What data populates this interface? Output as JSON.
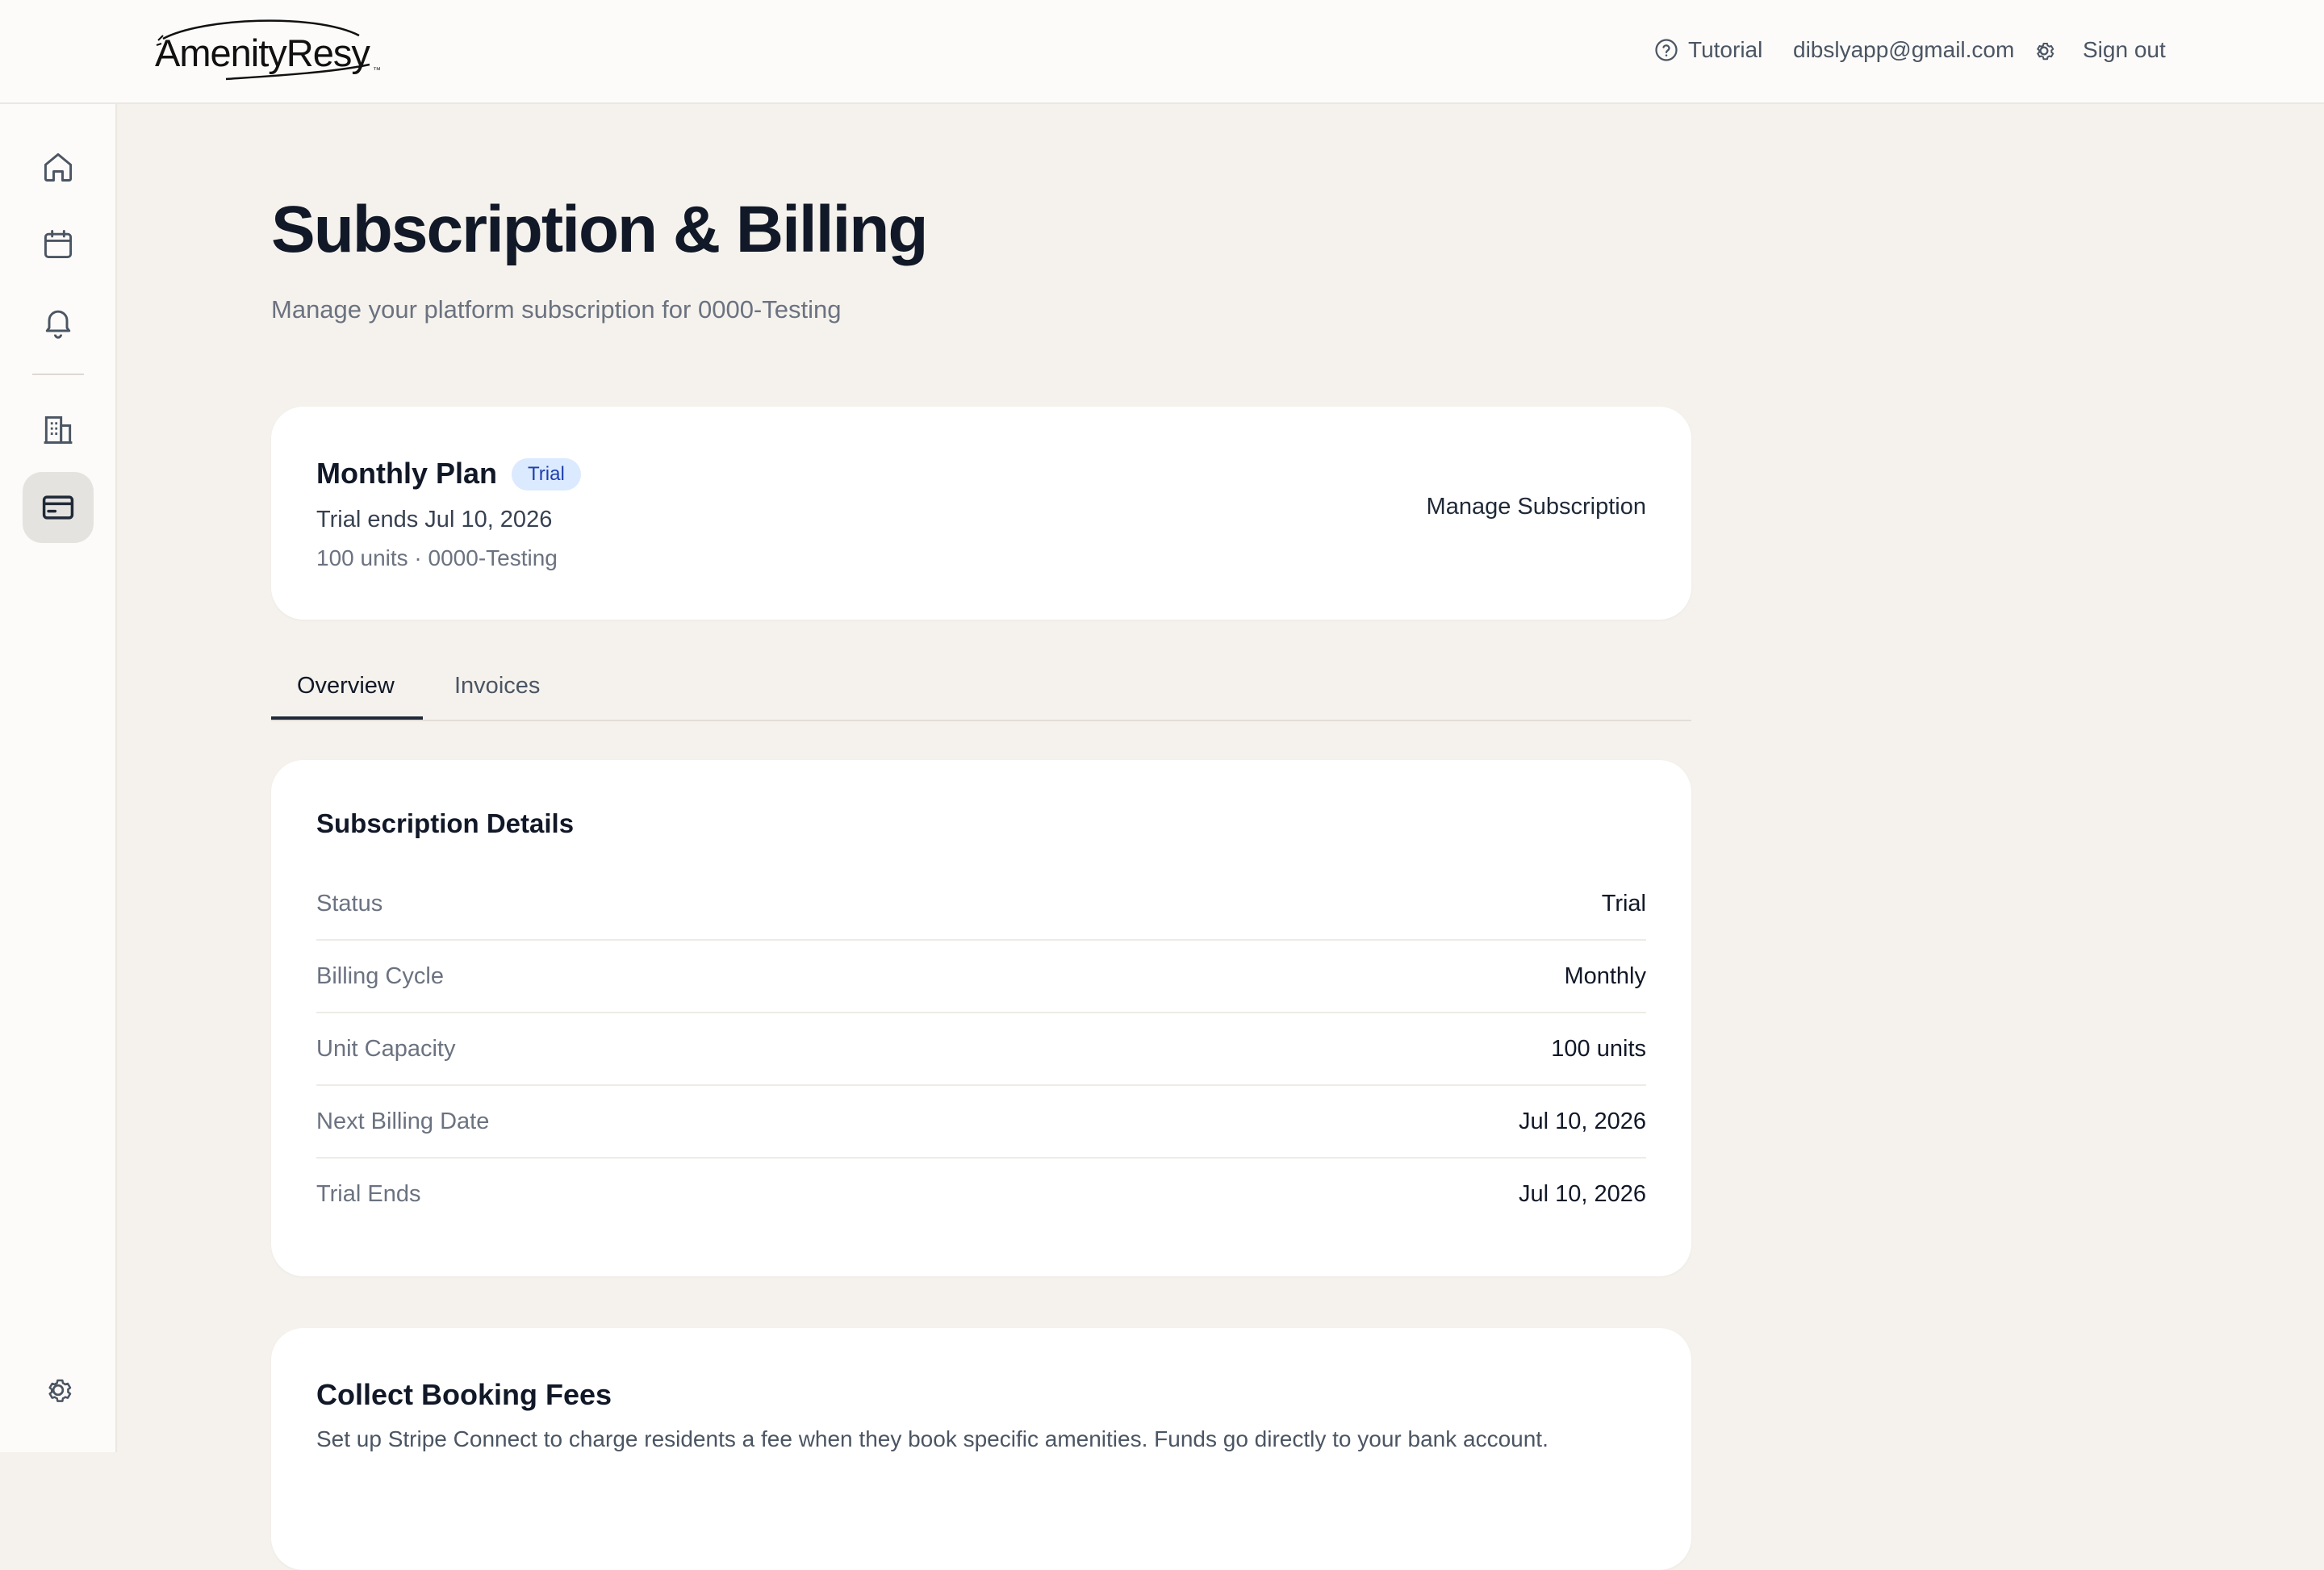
{
  "header": {
    "logo_text": "AmenityResy",
    "logo_tm": "™",
    "tutorial_label": "Tutorial",
    "user_email": "dibslyapp@gmail.com",
    "signout_label": "Sign out"
  },
  "sidebar": {
    "items": [
      {
        "icon": "home-icon",
        "active": false
      },
      {
        "icon": "calendar-icon",
        "active": false
      },
      {
        "icon": "bell-icon",
        "active": false
      },
      {
        "icon": "building-icon",
        "active": false
      },
      {
        "icon": "credit-card-icon",
        "active": true
      },
      {
        "icon": "gear-icon",
        "active": false
      }
    ]
  },
  "page": {
    "title": "Subscription & Billing",
    "subtitle": "Manage your platform subscription for 0000-Testing"
  },
  "plan": {
    "name": "Monthly Plan",
    "badge": "Trial",
    "trial_ends": "Trial ends Jul 10, 2026",
    "units_line": "100 units · 0000-Testing",
    "manage_label": "Manage Subscription"
  },
  "tabs": [
    {
      "label": "Overview",
      "active": true
    },
    {
      "label": "Invoices",
      "active": false
    }
  ],
  "details": {
    "title": "Subscription Details",
    "rows": [
      {
        "label": "Status",
        "value": "Trial"
      },
      {
        "label": "Billing Cycle",
        "value": "Monthly"
      },
      {
        "label": "Unit Capacity",
        "value": "100 units"
      },
      {
        "label": "Next Billing Date",
        "value": "Jul 10, 2026"
      },
      {
        "label": "Trial Ends",
        "value": "Jul 10, 2026"
      }
    ]
  },
  "fees": {
    "title": "Collect Booking Fees",
    "description": "Set up Stripe Connect to charge residents a fee when they book specific amenities. Funds go directly to your bank account."
  },
  "colors": {
    "background": "#f5f2ed",
    "badge_bg": "#dbeafe",
    "badge_text": "#1e40af",
    "active_tab": "#1f2937"
  }
}
